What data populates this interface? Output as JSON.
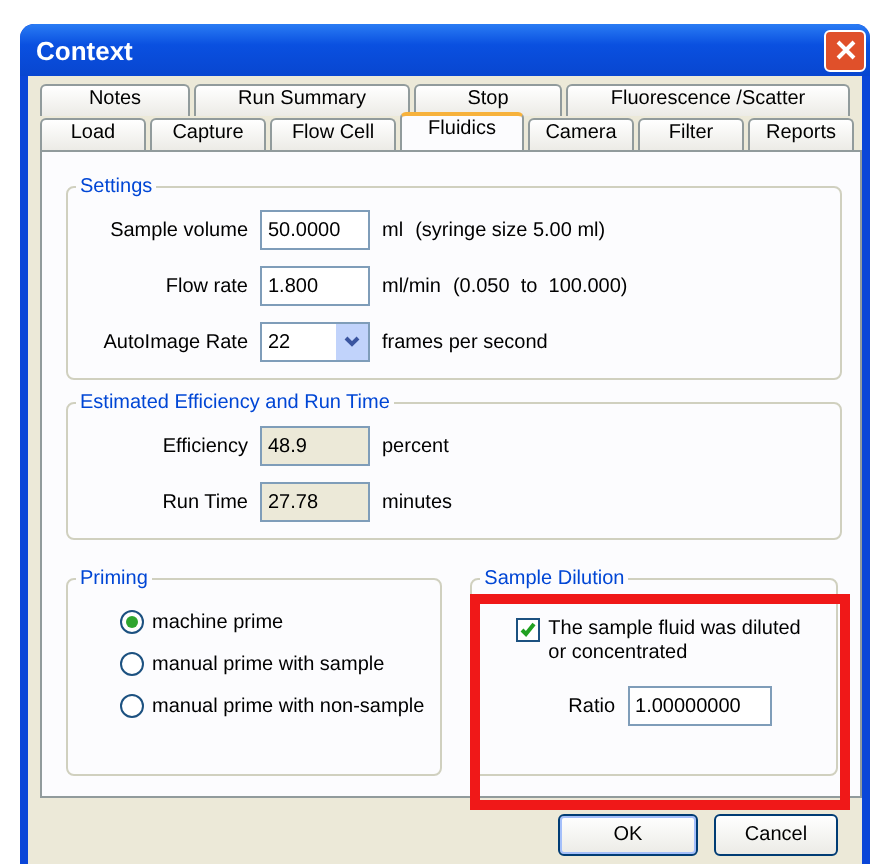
{
  "window": {
    "title": "Context"
  },
  "tab_rows": [
    [
      {
        "label": "Notes",
        "selected": false
      },
      {
        "label": "Run Summary",
        "selected": false
      },
      {
        "label": "Stop",
        "selected": false
      },
      {
        "label": "Fluorescence /Scatter",
        "selected": false
      }
    ],
    [
      {
        "label": "Load",
        "selected": false
      },
      {
        "label": "Capture",
        "selected": false
      },
      {
        "label": "Flow Cell",
        "selected": false
      },
      {
        "label": "Fluidics",
        "selected": true
      },
      {
        "label": "Camera",
        "selected": false
      },
      {
        "label": "Filter",
        "selected": false
      },
      {
        "label": "Reports",
        "selected": false
      }
    ]
  ],
  "settings": {
    "title": "Settings",
    "fields": [
      {
        "kind": "text",
        "label": "Sample volume",
        "value": "50.0000",
        "unit": "ml",
        "note": "(syringe size 5.00 ml)"
      },
      {
        "kind": "text",
        "label": "Flow rate",
        "value": "1.800",
        "unit": "ml/min",
        "note": "(0.050  to  100.000)"
      },
      {
        "kind": "dropdown",
        "label": "AutoImage Rate",
        "value": "22",
        "unit": "frames per second"
      }
    ]
  },
  "estimate": {
    "title": "Estimated Efficiency and Run Time",
    "fields": [
      {
        "label": "Efficiency",
        "value": "48.9",
        "unit": "percent"
      },
      {
        "label": "Run Time",
        "value": "27.78",
        "unit": "minutes"
      }
    ]
  },
  "priming": {
    "title": "Priming",
    "options": [
      {
        "label": "machine prime",
        "selected": true
      },
      {
        "label": "manual prime with sample",
        "selected": false
      },
      {
        "label": "manual prime with non-sample",
        "selected": false
      }
    ]
  },
  "dilution": {
    "title": "Sample Dilution",
    "checkbox": {
      "label": "The sample fluid was diluted or concentrated",
      "checked": true
    },
    "ratio_label": "Ratio",
    "ratio": "1.00000000"
  },
  "buttons": [
    "OK",
    "Cancel"
  ]
}
